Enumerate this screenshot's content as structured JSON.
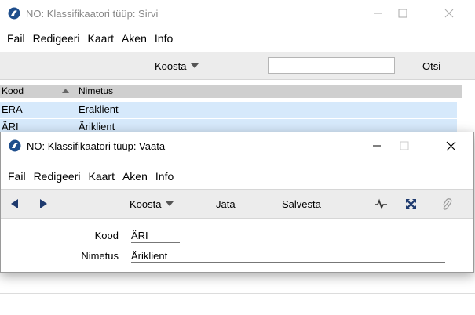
{
  "back_window": {
    "title": "NO: Klassifikaatori tüüp: Sirvi",
    "menu": [
      "Fail",
      "Redigeeri",
      "Kaart",
      "Aken",
      "Info"
    ],
    "toolbar": {
      "koosta_label": "Koosta",
      "search_value": "",
      "otsi_label": "Otsi"
    },
    "list": {
      "columns": [
        "Kood",
        "Nimetus"
      ],
      "rows": [
        {
          "kood": "ERA",
          "nimetus": "Eraklient"
        },
        {
          "kood": "ÄRI",
          "nimetus": "Äriklient"
        }
      ]
    }
  },
  "front_window": {
    "title": "NO: Klassifikaatori tüüp: Vaata",
    "menu": [
      "Fail",
      "Redigeeri",
      "Kaart",
      "Aken",
      "Info"
    ],
    "toolbar": {
      "koosta_label": "Koosta",
      "jata_label": "Jäta",
      "salvesta_label": "Salvesta"
    },
    "form": {
      "kood_label": "Kood",
      "kood_value": "ÄRI",
      "nimetus_label": "Nimetus",
      "nimetus_value": "Äriklient"
    }
  },
  "colors": {
    "selection": "#d6e9fb",
    "header": "#cfcfcf",
    "toolbar": "#ececec",
    "icon_blue": "#1e4e8c"
  }
}
